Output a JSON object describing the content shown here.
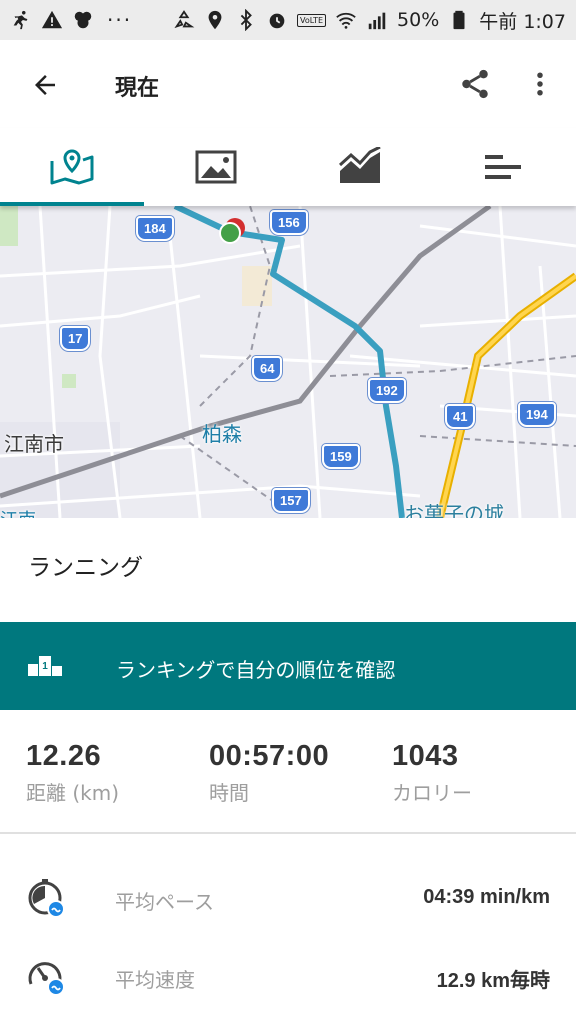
{
  "status_bar": {
    "battery": "50%",
    "time": "午前 1:07",
    "volte": "VoLTE",
    "more": "···",
    "icons": [
      "running-icon",
      "warning-icon",
      "notification-icon",
      "recycle-icon",
      "location-icon",
      "bluetooth-icon",
      "alarm-icon",
      "wifi-icon",
      "signal-icon",
      "battery-icon"
    ]
  },
  "header": {
    "title": "現在",
    "icons": [
      "back-arrow-icon",
      "share-icon",
      "more-vert-icon"
    ]
  },
  "tabs": [
    {
      "icon": "map-icon",
      "active": true
    },
    {
      "icon": "photo-icon",
      "active": false
    },
    {
      "icon": "chart-icon",
      "active": false
    },
    {
      "icon": "bar-list-icon",
      "active": false
    }
  ],
  "map": {
    "route_color": "#3a9fc0",
    "labels": {
      "city_left": "江南市",
      "station": "柏森",
      "shop": "お菓子の城",
      "bottom_left": "江南"
    },
    "route_shields": [
      "184",
      "156",
      "17",
      "64",
      "192",
      "41",
      "194",
      "159",
      "157"
    ]
  },
  "activity": {
    "type": "ランニング"
  },
  "ranking": {
    "label": "ランキングで自分の順位を確認",
    "badge_number": "1",
    "bg_color": "#00787e"
  },
  "stats": [
    {
      "value": "12.26",
      "label": "距離 (km)"
    },
    {
      "value": "00:57:00",
      "label": "時間"
    },
    {
      "value": "1043",
      "label": "カロリー"
    }
  ],
  "details": [
    {
      "icon": "pace-icon",
      "label": "平均ペース",
      "value": "04:39 min/km"
    },
    {
      "icon": "speed-icon",
      "label": "平均速度",
      "value": "12.9 km毎時"
    }
  ]
}
